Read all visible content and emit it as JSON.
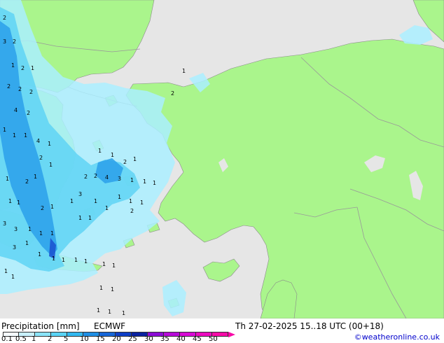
{
  "colors": {
    "sea": "#e6e6e6",
    "land": "#aaf58c",
    "border": "#999999",
    "precip_light": "#aaeeff",
    "precip_mid": "#5fd4f5",
    "precip_heavy": "#2aa0ea",
    "precip_peak": "#1a50d0"
  },
  "footer": {
    "title": "Precipitation [mm]",
    "model": "ECMWF",
    "validity": "Th 27-02-2025 15..18 UTC (00+18)",
    "credit": "©weatheronline.co.uk"
  },
  "legend": {
    "ticks": [
      "0.1",
      "0.5",
      "1",
      "2",
      "5",
      "10",
      "15",
      "20",
      "25",
      "30",
      "35",
      "40",
      "45",
      "50"
    ],
    "colors": [
      "#f5fbfe",
      "#c8f0fc",
      "#8ae4fa",
      "#5ad4f6",
      "#32b8f0",
      "#1e8ee4",
      "#1666d8",
      "#0e3ec6",
      "#0a22a0",
      "#8c0cd6",
      "#b60ad8",
      "#d80ad6",
      "#ec0ac0",
      "#f80aa8"
    ]
  },
  "map_labels": [
    {
      "text": "2",
      "name": "value-label"
    },
    {
      "text": "3",
      "name": "value-label"
    },
    {
      "text": "2",
      "name": "value-label"
    },
    {
      "text": "1",
      "name": "value-label"
    },
    {
      "text": "2",
      "name": "value-label"
    },
    {
      "text": "2",
      "name": "value-label"
    },
    {
      "text": "1",
      "name": "value-label"
    },
    {
      "text": "2",
      "name": "value-label"
    },
    {
      "text": "2",
      "name": "value-label"
    },
    {
      "text": "4",
      "name": "value-label"
    },
    {
      "text": "2",
      "name": "value-label"
    },
    {
      "text": "1",
      "name": "value-label"
    },
    {
      "text": "4",
      "name": "value-label"
    },
    {
      "text": "1",
      "name": "value-label"
    },
    {
      "text": "1",
      "name": "value-label"
    },
    {
      "text": "1",
      "name": "value-label"
    },
    {
      "text": "2",
      "name": "value-label"
    },
    {
      "text": "1",
      "name": "value-label"
    },
    {
      "text": "1",
      "name": "value-label"
    },
    {
      "text": "2",
      "name": "value-label"
    },
    {
      "text": "1",
      "name": "value-label"
    },
    {
      "text": "2",
      "name": "value-label"
    },
    {
      "text": "4",
      "name": "value-label"
    },
    {
      "text": "3",
      "name": "value-label"
    },
    {
      "text": "1",
      "name": "value-label"
    },
    {
      "text": "1",
      "name": "value-label"
    },
    {
      "text": "1",
      "name": "value-label"
    },
    {
      "text": "3",
      "name": "value-label"
    },
    {
      "text": "2",
      "name": "value-label"
    },
    {
      "text": "1",
      "name": "value-label"
    },
    {
      "text": "1",
      "name": "value-label"
    },
    {
      "text": "2",
      "name": "value-label"
    },
    {
      "text": "1",
      "name": "value-label"
    },
    {
      "text": "1",
      "name": "value-label"
    },
    {
      "text": "1",
      "name": "value-label"
    },
    {
      "text": "1",
      "name": "value-label"
    },
    {
      "text": "3",
      "name": "value-label"
    },
    {
      "text": "3",
      "name": "value-label"
    },
    {
      "text": "1",
      "name": "value-label"
    },
    {
      "text": "1",
      "name": "value-label"
    },
    {
      "text": "1",
      "name": "value-label"
    },
    {
      "text": "1",
      "name": "value-label"
    },
    {
      "text": "1",
      "name": "value-label"
    },
    {
      "text": "1",
      "name": "value-label"
    },
    {
      "text": "2",
      "name": "value-label"
    },
    {
      "text": "1",
      "name": "value-label"
    },
    {
      "text": "1",
      "name": "value-label"
    },
    {
      "text": "2",
      "name": "value-label"
    },
    {
      "text": "1",
      "name": "value-label"
    },
    {
      "text": "1",
      "name": "value-label"
    },
    {
      "text": "1",
      "name": "value-label"
    },
    {
      "text": "1",
      "name": "value-label"
    },
    {
      "text": "2",
      "name": "value-label"
    },
    {
      "text": "1",
      "name": "value-label"
    },
    {
      "text": "3",
      "name": "value-label"
    },
    {
      "text": "1",
      "name": "value-label"
    },
    {
      "text": "1",
      "name": "value-label"
    },
    {
      "text": "1",
      "name": "value-label"
    },
    {
      "text": "1",
      "name": "value-label"
    },
    {
      "text": "1",
      "name": "value-label"
    },
    {
      "text": "1",
      "name": "value-label"
    },
    {
      "text": "1",
      "name": "value-label"
    },
    {
      "text": "1",
      "name": "value-label"
    },
    {
      "text": "1",
      "name": "value-label"
    },
    {
      "text": "1",
      "name": "value-label"
    },
    {
      "text": "1",
      "name": "value-label"
    },
    {
      "text": "1",
      "name": "value-label"
    },
    {
      "text": "1",
      "name": "value-label"
    },
    {
      "text": "1",
      "name": "value-label"
    }
  ]
}
